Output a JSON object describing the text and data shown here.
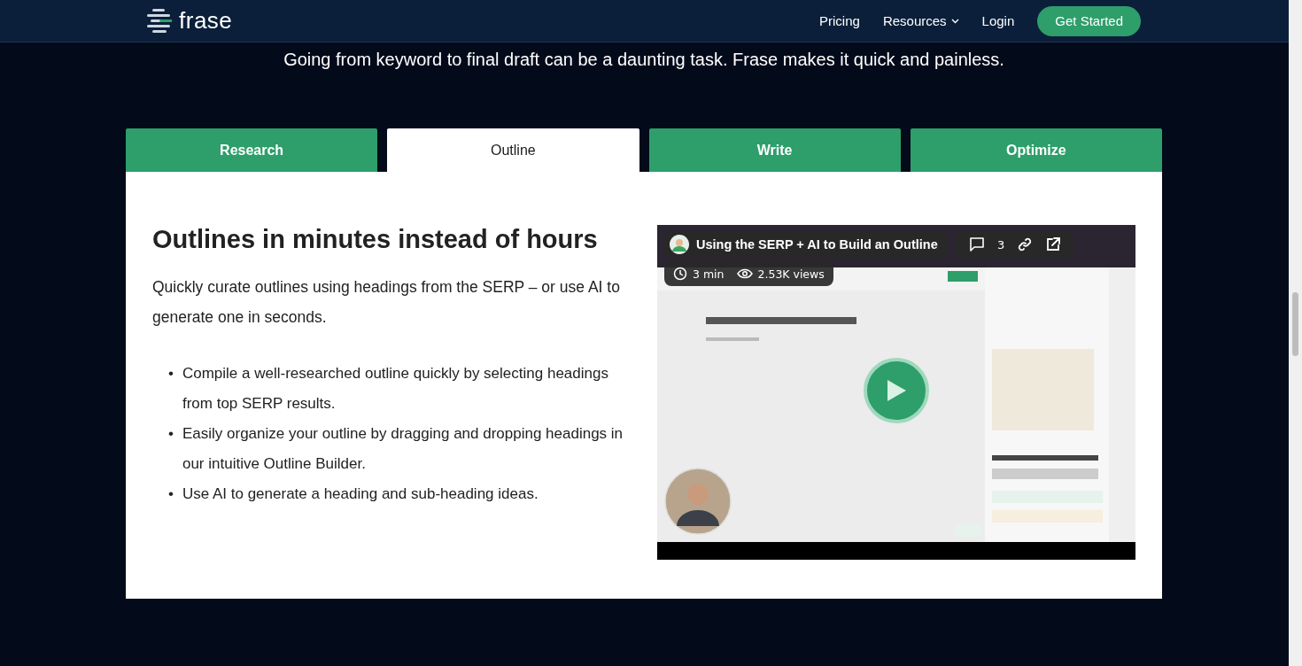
{
  "header": {
    "logo": "frase",
    "nav": [
      {
        "label": "Pricing",
        "kind": "link"
      },
      {
        "label": "Resources",
        "kind": "dropdown"
      },
      {
        "label": "Login",
        "kind": "link"
      }
    ],
    "cta": "Get Started"
  },
  "intro": "Going from keyword to final draft can be a daunting task. Frase makes it quick and painless.",
  "tabs": [
    {
      "label": "Research",
      "selected": false
    },
    {
      "label": "Outline",
      "selected": true
    },
    {
      "label": "Write",
      "selected": false
    },
    {
      "label": "Optimize",
      "selected": false
    }
  ],
  "panel": {
    "heading": "Outlines in minutes instead of hours",
    "description": "Quickly curate outlines using headings from the SERP – or use AI to generate one in seconds.",
    "bullets": [
      {
        "marker": "•",
        "text": "Compile a well-researched outline quickly by selecting headings from top SERP results."
      },
      {
        "marker": "•",
        "text": "Easily organize your outline by dragging and dropping headings in our intuitive Outline Builder."
      },
      {
        "marker": "•",
        "text": "Use AI to generate a heading and sub-heading ideas."
      }
    ],
    "video": {
      "title": "Using the SERP + AI to Build an Outline",
      "comments": "3",
      "duration": "3 min",
      "views": "2.53K views"
    }
  }
}
